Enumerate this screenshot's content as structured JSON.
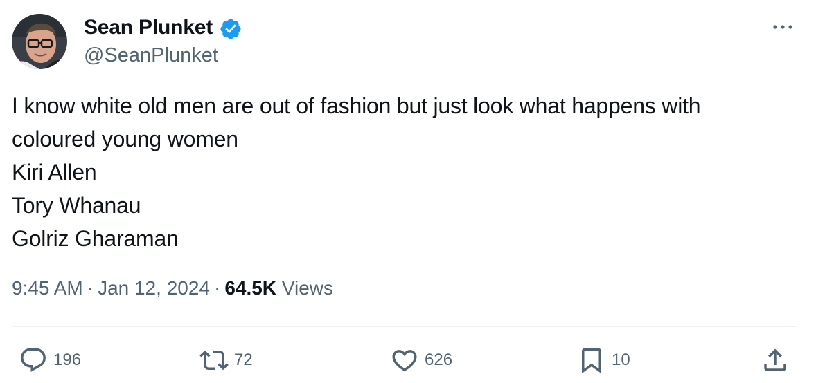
{
  "author": {
    "display_name": "Sean Plunket",
    "handle": "@SeanPlunket",
    "verified": true,
    "verified_color": "#1d9bf0"
  },
  "tweet": {
    "lines": [
      "I know white old men are out of fashion but just look what happens with",
      "coloured young women",
      "Kiri Allen",
      "Tory Whanau",
      "Golriz Gharaman"
    ]
  },
  "meta": {
    "time": "9:45 AM",
    "separator": "·",
    "date": "Jan 12, 2024",
    "views_count": "64.5K",
    "views_label": "Views"
  },
  "actions": {
    "replies": "196",
    "retweets": "72",
    "likes": "626",
    "bookmarks": "10"
  },
  "icons": {
    "more": "more-horizontal-icon",
    "reply": "reply-icon",
    "retweet": "retweet-icon",
    "like": "heart-icon",
    "bookmark": "bookmark-icon",
    "share": "share-icon"
  }
}
